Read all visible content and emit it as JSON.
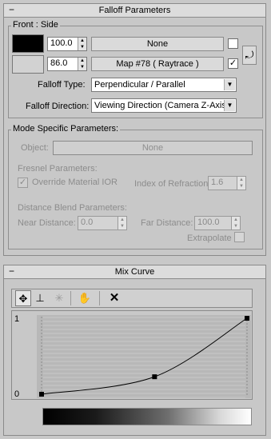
{
  "falloff": {
    "title": "Falloff Parameters",
    "group_title": "Front : Side",
    "row1": {
      "value": "100.0",
      "map_label": "None",
      "checked": false
    },
    "row2": {
      "value": "86.0",
      "map_label": "Map #78  ( Raytrace )",
      "checked": true
    },
    "swap_icon": "swap-icon",
    "type_label": "Falloff Type:",
    "type_value": "Perpendicular / Parallel",
    "direction_label": "Falloff Direction:",
    "direction_value": "Viewing Direction (Camera Z-Axis)"
  },
  "mode": {
    "group_title": "Mode Specific Parameters:",
    "object_label": "Object:",
    "object_button": "None",
    "fresnel_title": "Fresnel Parameters:",
    "override_label": "Override Material IOR",
    "override_checked": true,
    "ior_label": "Index of Refraction",
    "ior_value": "1.6",
    "blend_title": "Distance Blend Parameters:",
    "near_label": "Near Distance:",
    "near_value": "0.0",
    "far_label": "Far Distance:",
    "far_value": "100.0",
    "extrapolate_label": "Extrapolate",
    "extrapolate_checked": false
  },
  "mix_curve": {
    "title": "Mix Curve",
    "tools": [
      "move-icon",
      "scale-vertical-icon",
      "insert-point-icon",
      "pan-hand-icon",
      "delete-icon"
    ],
    "y_max_label": "1",
    "y_min_label": "0",
    "curve_points": [
      [
        0,
        0
      ],
      [
        0.55,
        0.23
      ],
      [
        1,
        1
      ]
    ]
  },
  "colors": {
    "swatch_black": "#000000",
    "swatch_gray": "#d2d2d2",
    "panel_bg": "#c8c8c8"
  }
}
